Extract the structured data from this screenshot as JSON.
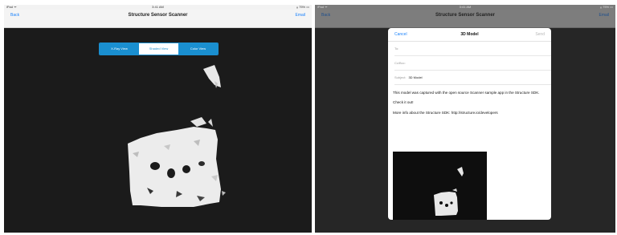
{
  "left_screen": {
    "status": {
      "carrier": "iPad ᯤ",
      "time": "3:41 AM",
      "battery": "⁎ 75% ▭"
    },
    "nav": {
      "back": "Back",
      "title": "Structure Sensor Scanner",
      "right": "Email"
    },
    "segments": [
      {
        "label": "X-Ray View",
        "selected": false
      },
      {
        "label": "Shaded View",
        "selected": true
      },
      {
        "label": "Color View",
        "selected": false
      }
    ]
  },
  "right_screen": {
    "status": {
      "carrier": "iPad ᯤ",
      "time": "3:41 AM",
      "battery": "⁎ 75% ▭"
    },
    "nav": {
      "back": "Back",
      "title": "Structure Sensor Scanner",
      "right": "Email"
    },
    "compose": {
      "cancel": "Cancel",
      "title": "3D Model",
      "send": "Send",
      "to_label": "To:",
      "cc_label": "Cc/Bcc:",
      "subject_label": "Subject:",
      "subject_value": "3D Model",
      "body": [
        "This model was captured with the open source Scanner sample app in the Structure SDK.",
        "Check it out!",
        "More info about the Structure SDK: http://structure.io/developers"
      ]
    }
  },
  "colors": {
    "accent": "#1a8fd0",
    "link": "#1a82fb",
    "canvas": "#1b1b1b"
  }
}
